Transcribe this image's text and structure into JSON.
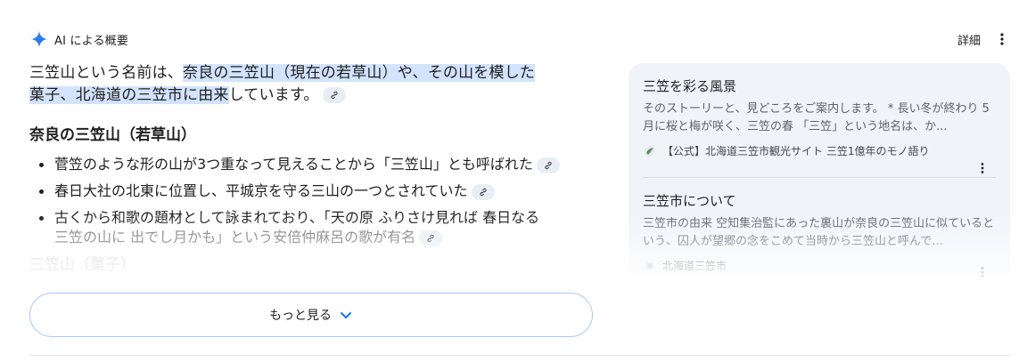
{
  "header": {
    "title": "AI による概要",
    "details_label": "詳細"
  },
  "overview": {
    "intro_pre": "三笠山という名前は、",
    "intro_highlight_1": "奈良の三笠山（現在の若草山）や、その山を模した",
    "intro_highlight_2": "菓子、北海道の三笠市に由来",
    "intro_post": "しています。",
    "section_1_heading": "奈良の三笠山（若草山）",
    "bullets": [
      {
        "text": "菅笠のような形の山が3つ重なって見えることから「三笠山」とも呼ばれた",
        "faded": ""
      },
      {
        "text": "春日大社の北東に位置し、平城京を守る三山の一つとされていた",
        "faded": ""
      },
      {
        "text": "古くから和歌の題材として詠まれており、「天の原 ふりさけ見れば 春日なる",
        "faded": "三笠の山に 出でし月かも」という安倍仲麻呂の歌が有名"
      }
    ],
    "section_2_heading": "三笠山（菓子）"
  },
  "more_button": {
    "label": "もっと見る"
  },
  "sources": [
    {
      "title": "三笠を彩る風景",
      "snippet": "そのストーリーと、見どころをご案内します。 * 長い冬が終わり 5月に桜と梅が咲く、三笠の春 「三笠」という地名は、か...",
      "site": "【公式】北海道三笠市観光サイト 三笠1億年のモノ語り"
    },
    {
      "title": "三笠市について",
      "snippet": "三笠市の由来 空知集治監にあった裏山が奈良の三笠山に似ているという、囚人が望郷の念をこめて当時から三笠山と呼んで...",
      "site": "北海道三笠市"
    }
  ],
  "colors": {
    "highlight": "#d3e3fd",
    "panel_bg": "#f0f4f9",
    "button_border": "#a8c7fa",
    "accent_blue": "#1a73e8"
  }
}
